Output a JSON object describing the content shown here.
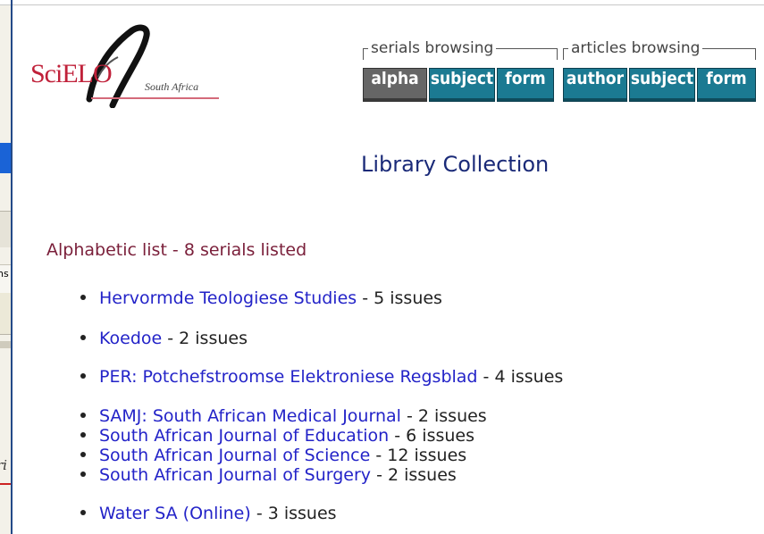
{
  "logo": {
    "text_prefix": "Sci",
    "text_suffix": "ELO",
    "region": "South Africa"
  },
  "serials_browsing": {
    "legend": "serials browsing",
    "buttons": [
      {
        "label": "alpha",
        "active": true
      },
      {
        "label": "subject",
        "active": false
      },
      {
        "label": "form",
        "active": false
      }
    ]
  },
  "articles_browsing": {
    "legend": "articles browsing",
    "buttons": [
      {
        "label": "author",
        "active": false
      },
      {
        "label": "subject",
        "active": false
      },
      {
        "label": "form",
        "active": false
      }
    ]
  },
  "page_title": "Library Collection",
  "list_heading": "Alphabetic list - 8 serials listed",
  "serials": [
    {
      "name": "Hervormde Teologiese Studies",
      "issues": "- 5  issues"
    },
    {
      "name": "Koedoe",
      "issues": "- 2  issues"
    },
    {
      "name": "PER: Potchefstroomse Elektroniese Regsblad",
      "issues": "- 4  issues"
    },
    {
      "name": "SAMJ: South African Medical Journal",
      "issues": "- 2  issues"
    },
    {
      "name": "South African Journal of Education",
      "issues": "- 6  issues"
    },
    {
      "name": "South African Journal of Science",
      "issues": "- 12  issues"
    },
    {
      "name": "South African Journal of Surgery",
      "issues": "- 2  issues"
    },
    {
      "name": "Water SA (Online)",
      "issues": "- 3  issues"
    }
  ],
  "background_window": {
    "fragment_ns": "ns",
    "fragment_ri": "ri"
  },
  "colors": {
    "button": "#1b7a92",
    "button_active": "#666666",
    "link": "#2323c8",
    "heading": "#7a1f3a",
    "title": "#1a2a78",
    "logo_red": "#c0213a"
  }
}
